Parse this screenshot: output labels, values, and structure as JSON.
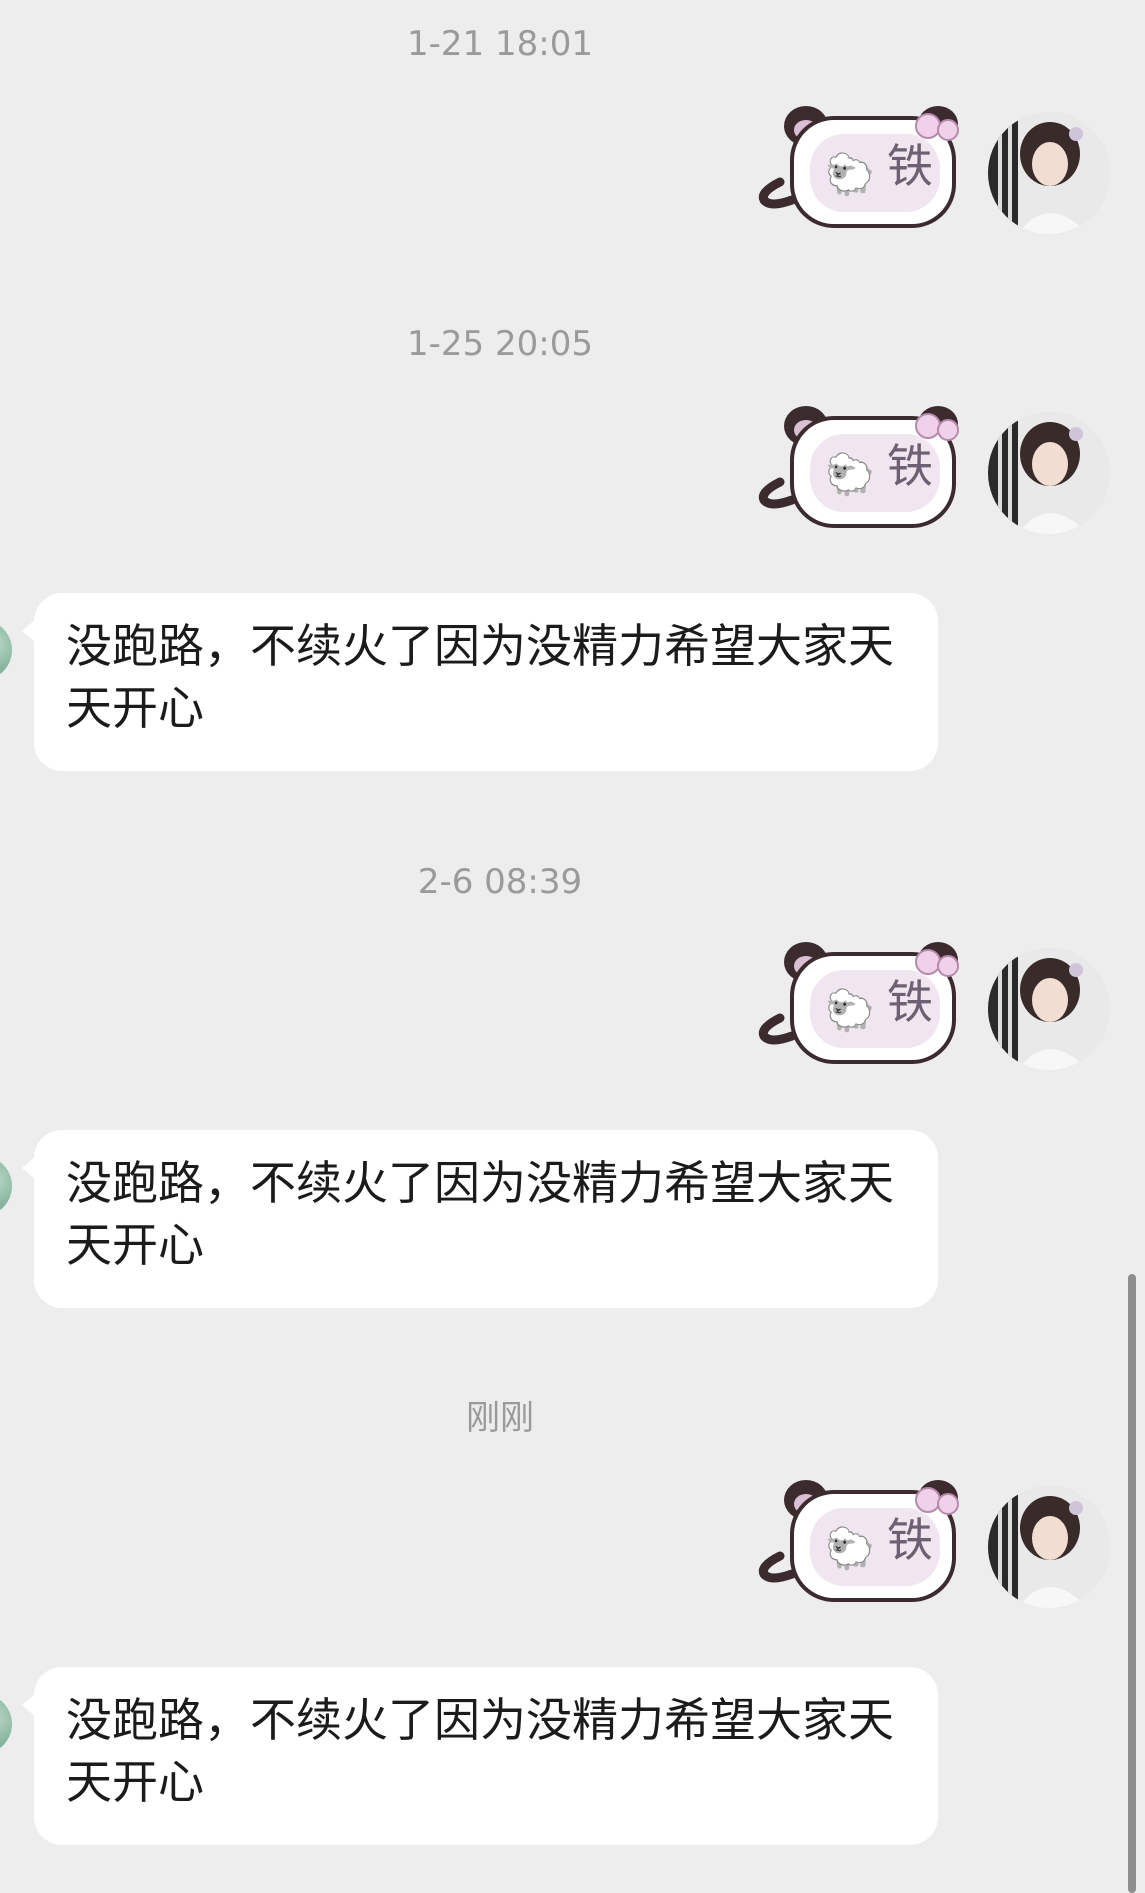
{
  "messages": [
    {
      "time": "1-21 18:01",
      "sticker": {
        "emoji": "🐑",
        "char": "铁",
        "name": "sheep-tie-sticker"
      }
    },
    {
      "time": "1-25 20:05",
      "sticker": {
        "emoji": "🐑",
        "char": "铁",
        "name": "sheep-tie-sticker"
      },
      "reply": "没跑路，不续火了因为没精力希望大家天天开心"
    },
    {
      "time": "2-6 08:39",
      "sticker": {
        "emoji": "🐑",
        "char": "铁",
        "name": "sheep-tie-sticker"
      },
      "reply": "没跑路，不续火了因为没精力希望大家天天开心"
    },
    {
      "time": "刚刚",
      "sticker": {
        "emoji": "🐑",
        "char": "铁",
        "name": "sheep-tie-sticker"
      },
      "reply": "没跑路，不续火了因为没精力希望大家天天开心"
    }
  ],
  "colors": {
    "background": "#ededed",
    "bubble": "#ffffff",
    "timestamp_text": "#9a9a9a",
    "sticker_fill": "#efe6ef",
    "sticker_ears": "#3b2b2e"
  }
}
